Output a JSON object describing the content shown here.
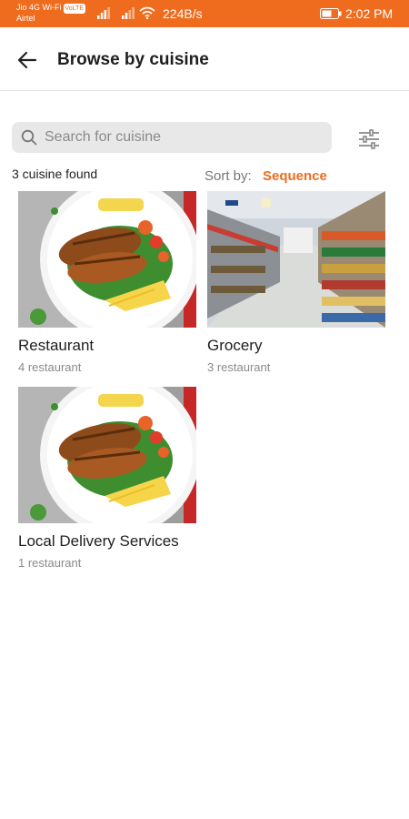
{
  "status_bar": {
    "carrier_line1": "Jio 4G Wi-Fi",
    "volte": "VoLTE",
    "carrier_line2": "Airtel",
    "speed": "224B/s",
    "time": "2:02 PM",
    "color": "#ef6c1e"
  },
  "header": {
    "title": "Browse by cuisine",
    "back_icon": "arrow-left-icon"
  },
  "search": {
    "placeholder": "Search for cuisine",
    "value": "",
    "filter_icon": "sliders-icon"
  },
  "results": {
    "count_text": "3 cuisine found",
    "sort_label": "Sort by:",
    "sort_value": "Sequence"
  },
  "cuisines": [
    {
      "name": "Restaurant",
      "count": "4 restaurant",
      "image": "food-plate"
    },
    {
      "name": "Grocery",
      "count": "3 restaurant",
      "image": "grocery-aisle"
    },
    {
      "name": "Local Delivery Services",
      "count": "1 restaurant",
      "image": "food-plate"
    }
  ],
  "accent_color": "#ef6c1e"
}
